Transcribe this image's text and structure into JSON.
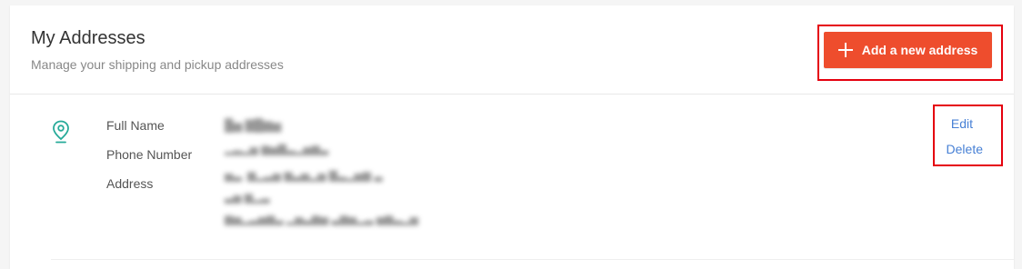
{
  "page": {
    "title": "My Addresses",
    "subtitle": "Manage your shipping and pickup addresses"
  },
  "actions": {
    "add_address_label": "Add a new address",
    "add_icon": "plus-icon"
  },
  "address": {
    "icon": "location-pin-icon",
    "labels": {
      "full_name": "Full Name",
      "phone": "Phone Number",
      "address": "Address"
    },
    "values": {
      "full_name": "",
      "phone": "",
      "address_lines": [
        "",
        "",
        ""
      ]
    },
    "edit_label": "Edit",
    "delete_label": "Delete"
  },
  "colors": {
    "accent": "#ee4d2d",
    "link": "#4780d5",
    "pin": "#26aa99",
    "highlight": "#e5000e"
  }
}
